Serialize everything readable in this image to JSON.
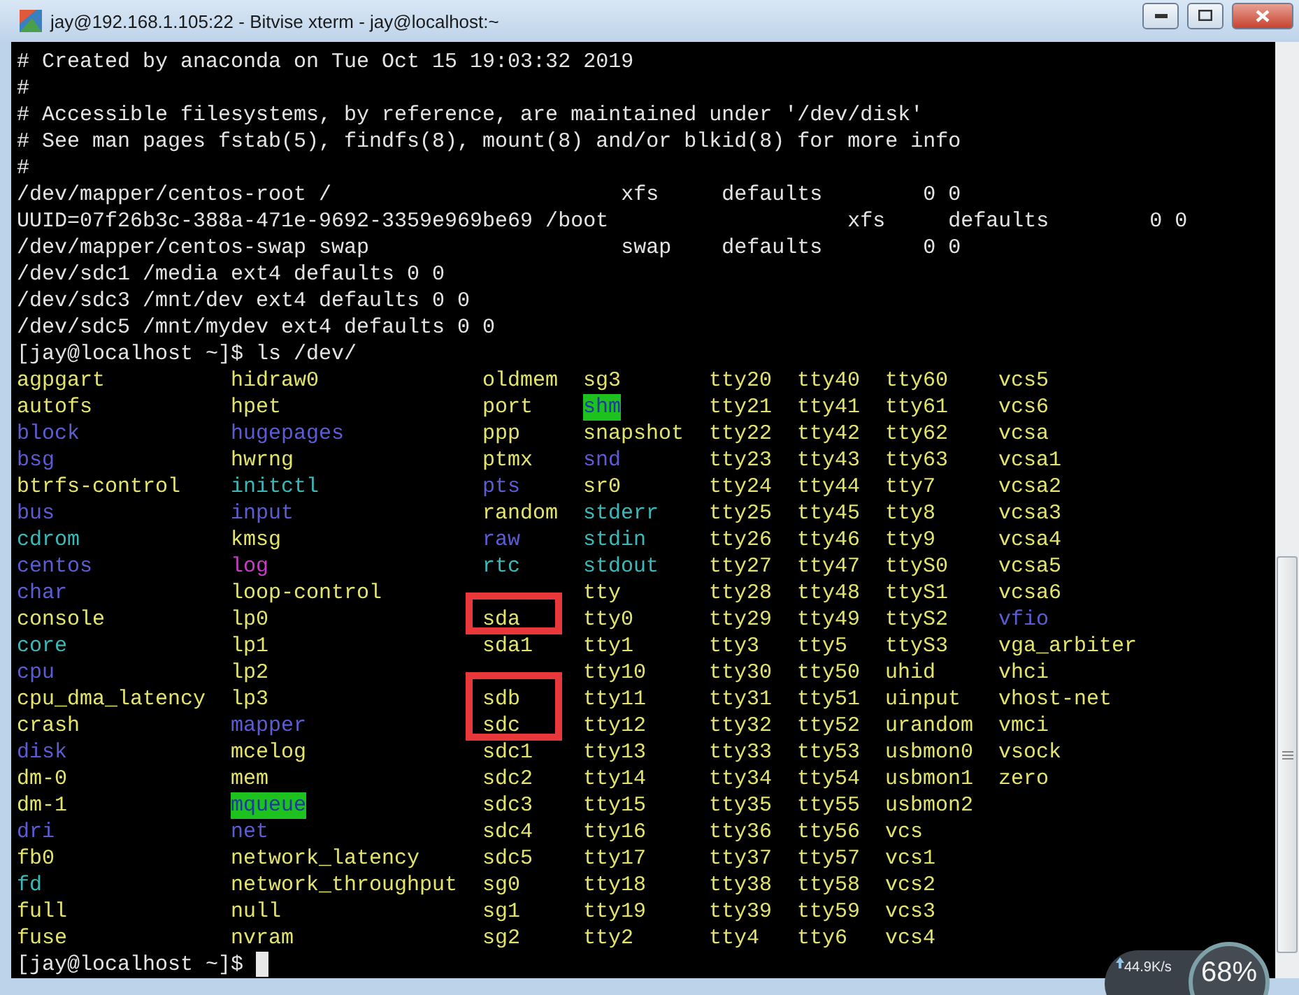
{
  "window": {
    "title": "jay@192.168.1.105:22 - Bitvise xterm - jay@localhost:~"
  },
  "terminal": {
    "lines": [
      "# Created by anaconda on Tue Oct 15 19:03:32 2019",
      "#",
      "# Accessible filesystems, by reference, are maintained under '/dev/disk'",
      "# See man pages fstab(5), findfs(8), mount(8) and/or blkid(8) for more info",
      "#",
      "/dev/mapper/centos-root /                       xfs     defaults        0 0",
      "UUID=07f26b3c-388a-471e-9692-3359e969be69 /boot                   xfs     defaults        0 0",
      "/dev/mapper/centos-swap swap                    swap    defaults        0 0",
      "/dev/sdc1 /media ext4 defaults 0 0",
      "/dev/sdc3 /mnt/dev ext4 defaults 0 0",
      "/dev/sdc5 /mnt/mydev ext4 defaults 0 0",
      "[jay@localhost ~]$ ls /dev/"
    ],
    "listing": {
      "columns": [
        {
          "entries": [
            {
              "name": "agpgart",
              "kind": "dev"
            },
            {
              "name": "autofs",
              "kind": "dev"
            },
            {
              "name": "block",
              "kind": "dir"
            },
            {
              "name": "bsg",
              "kind": "dir"
            },
            {
              "name": "btrfs-control",
              "kind": "dev"
            },
            {
              "name": "bus",
              "kind": "dir"
            },
            {
              "name": "cdrom",
              "kind": "link"
            },
            {
              "name": "centos",
              "kind": "dir"
            },
            {
              "name": "char",
              "kind": "dir"
            },
            {
              "name": "console",
              "kind": "dev"
            },
            {
              "name": "core",
              "kind": "link"
            },
            {
              "name": "cpu",
              "kind": "dir"
            },
            {
              "name": "cpu_dma_latency",
              "kind": "dev"
            },
            {
              "name": "crash",
              "kind": "dev"
            },
            {
              "name": "disk",
              "kind": "dir"
            },
            {
              "name": "dm-0",
              "kind": "dev"
            },
            {
              "name": "dm-1",
              "kind": "dev"
            },
            {
              "name": "dri",
              "kind": "dir"
            },
            {
              "name": "fb0",
              "kind": "dev"
            },
            {
              "name": "fd",
              "kind": "link"
            },
            {
              "name": "full",
              "kind": "dev"
            },
            {
              "name": "fuse",
              "kind": "dev"
            }
          ]
        },
        {
          "entries": [
            {
              "name": "hidraw0",
              "kind": "dev"
            },
            {
              "name": "hpet",
              "kind": "dev"
            },
            {
              "name": "hugepages",
              "kind": "dir"
            },
            {
              "name": "hwrng",
              "kind": "dev"
            },
            {
              "name": "initctl",
              "kind": "link"
            },
            {
              "name": "input",
              "kind": "dir"
            },
            {
              "name": "kmsg",
              "kind": "dev"
            },
            {
              "name": "log",
              "kind": "sock"
            },
            {
              "name": "loop-control",
              "kind": "dev"
            },
            {
              "name": "lp0",
              "kind": "dev"
            },
            {
              "name": "lp1",
              "kind": "dev"
            },
            {
              "name": "lp2",
              "kind": "dev"
            },
            {
              "name": "lp3",
              "kind": "dev"
            },
            {
              "name": "mapper",
              "kind": "dir"
            },
            {
              "name": "mcelog",
              "kind": "dev"
            },
            {
              "name": "mem",
              "kind": "dev"
            },
            {
              "name": "mqueue",
              "kind": "sticky"
            },
            {
              "name": "net",
              "kind": "dir"
            },
            {
              "name": "network_latency",
              "kind": "dev"
            },
            {
              "name": "network_throughput",
              "kind": "dev"
            },
            {
              "name": "null",
              "kind": "dev"
            },
            {
              "name": "nvram",
              "kind": "dev"
            }
          ]
        },
        {
          "entries": [
            {
              "name": "oldmem",
              "kind": "dev"
            },
            {
              "name": "port",
              "kind": "dev"
            },
            {
              "name": "ppp",
              "kind": "dev"
            },
            {
              "name": "ptmx",
              "kind": "dev"
            },
            {
              "name": "pts",
              "kind": "dir"
            },
            {
              "name": "random",
              "kind": "dev"
            },
            {
              "name": "raw",
              "kind": "dir"
            },
            {
              "name": "rtc",
              "kind": "link"
            },
            {
              "kind": "covered"
            },
            {
              "name": "sda",
              "kind": "dev",
              "marked": true
            },
            {
              "name": "sda1",
              "kind": "dev"
            },
            {
              "kind": "covered"
            },
            {
              "name": "sdb",
              "kind": "dev",
              "marked": true
            },
            {
              "name": "sdc",
              "kind": "dev",
              "marked": true
            },
            {
              "name": "sdc1",
              "kind": "dev"
            },
            {
              "name": "sdc2",
              "kind": "dev"
            },
            {
              "name": "sdc3",
              "kind": "dev"
            },
            {
              "name": "sdc4",
              "kind": "dev"
            },
            {
              "name": "sdc5",
              "kind": "dev"
            },
            {
              "name": "sg0",
              "kind": "dev"
            },
            {
              "name": "sg1",
              "kind": "dev"
            },
            {
              "name": "sg2",
              "kind": "dev"
            }
          ]
        },
        {
          "entries": [
            {
              "name": "sg3",
              "kind": "dev"
            },
            {
              "name": "shm",
              "kind": "sticky"
            },
            {
              "name": "snapshot",
              "kind": "dev"
            },
            {
              "name": "snd",
              "kind": "dir"
            },
            {
              "name": "sr0",
              "kind": "dev"
            },
            {
              "name": "stderr",
              "kind": "link"
            },
            {
              "name": "stdin",
              "kind": "link"
            },
            {
              "name": "stdout",
              "kind": "link"
            },
            {
              "name": "tty",
              "kind": "dev"
            },
            {
              "name": "tty0",
              "kind": "dev"
            },
            {
              "name": "tty1",
              "kind": "dev"
            },
            {
              "name": "tty10",
              "kind": "dev"
            },
            {
              "name": "tty11",
              "kind": "dev"
            },
            {
              "name": "tty12",
              "kind": "dev"
            },
            {
              "name": "tty13",
              "kind": "dev"
            },
            {
              "name": "tty14",
              "kind": "dev"
            },
            {
              "name": "tty15",
              "kind": "dev"
            },
            {
              "name": "tty16",
              "kind": "dev"
            },
            {
              "name": "tty17",
              "kind": "dev"
            },
            {
              "name": "tty18",
              "kind": "dev"
            },
            {
              "name": "tty19",
              "kind": "dev"
            },
            {
              "name": "tty2",
              "kind": "dev"
            }
          ]
        },
        {
          "entries": [
            {
              "name": "tty20",
              "kind": "dev"
            },
            {
              "name": "tty21",
              "kind": "dev"
            },
            {
              "name": "tty22",
              "kind": "dev"
            },
            {
              "name": "tty23",
              "kind": "dev"
            },
            {
              "name": "tty24",
              "kind": "dev"
            },
            {
              "name": "tty25",
              "kind": "dev"
            },
            {
              "name": "tty26",
              "kind": "dev"
            },
            {
              "name": "tty27",
              "kind": "dev"
            },
            {
              "name": "tty28",
              "kind": "dev"
            },
            {
              "name": "tty29",
              "kind": "dev"
            },
            {
              "name": "tty3",
              "kind": "dev"
            },
            {
              "name": "tty30",
              "kind": "dev"
            },
            {
              "name": "tty31",
              "kind": "dev"
            },
            {
              "name": "tty32",
              "kind": "dev"
            },
            {
              "name": "tty33",
              "kind": "dev"
            },
            {
              "name": "tty34",
              "kind": "dev"
            },
            {
              "name": "tty35",
              "kind": "dev"
            },
            {
              "name": "tty36",
              "kind": "dev"
            },
            {
              "name": "tty37",
              "kind": "dev"
            },
            {
              "name": "tty38",
              "kind": "dev"
            },
            {
              "name": "tty39",
              "kind": "dev"
            },
            {
              "name": "tty4",
              "kind": "dev"
            }
          ]
        },
        {
          "entries": [
            {
              "name": "tty40",
              "kind": "dev"
            },
            {
              "name": "tty41",
              "kind": "dev"
            },
            {
              "name": "tty42",
              "kind": "dev"
            },
            {
              "name": "tty43",
              "kind": "dev"
            },
            {
              "name": "tty44",
              "kind": "dev"
            },
            {
              "name": "tty45",
              "kind": "dev"
            },
            {
              "name": "tty46",
              "kind": "dev"
            },
            {
              "name": "tty47",
              "kind": "dev"
            },
            {
              "name": "tty48",
              "kind": "dev"
            },
            {
              "name": "tty49",
              "kind": "dev"
            },
            {
              "name": "tty5",
              "kind": "dev"
            },
            {
              "name": "tty50",
              "kind": "dev"
            },
            {
              "name": "tty51",
              "kind": "dev"
            },
            {
              "name": "tty52",
              "kind": "dev"
            },
            {
              "name": "tty53",
              "kind": "dev"
            },
            {
              "name": "tty54",
              "kind": "dev"
            },
            {
              "name": "tty55",
              "kind": "dev"
            },
            {
              "name": "tty56",
              "kind": "dev"
            },
            {
              "name": "tty57",
              "kind": "dev"
            },
            {
              "name": "tty58",
              "kind": "dev"
            },
            {
              "name": "tty59",
              "kind": "dev"
            },
            {
              "name": "tty6",
              "kind": "dev"
            }
          ]
        },
        {
          "entries": [
            {
              "name": "tty60",
              "kind": "dev"
            },
            {
              "name": "tty61",
              "kind": "dev"
            },
            {
              "name": "tty62",
              "kind": "dev"
            },
            {
              "name": "tty63",
              "kind": "dev"
            },
            {
              "name": "tty7",
              "kind": "dev"
            },
            {
              "name": "tty8",
              "kind": "dev"
            },
            {
              "name": "tty9",
              "kind": "dev"
            },
            {
              "name": "ttyS0",
              "kind": "dev"
            },
            {
              "name": "ttyS1",
              "kind": "dev"
            },
            {
              "name": "ttyS2",
              "kind": "dev"
            },
            {
              "name": "ttyS3",
              "kind": "dev"
            },
            {
              "name": "uhid",
              "kind": "dev"
            },
            {
              "name": "uinput",
              "kind": "dev"
            },
            {
              "name": "urandom",
              "kind": "dev"
            },
            {
              "name": "usbmon0",
              "kind": "dev"
            },
            {
              "name": "usbmon1",
              "kind": "dev"
            },
            {
              "name": "usbmon2",
              "kind": "dev"
            },
            {
              "name": "vcs",
              "kind": "dev"
            },
            {
              "name": "vcs1",
              "kind": "dev"
            },
            {
              "name": "vcs2",
              "kind": "dev"
            },
            {
              "name": "vcs3",
              "kind": "dev"
            },
            {
              "name": "vcs4",
              "kind": "dev"
            }
          ]
        },
        {
          "entries": [
            {
              "name": "vcs5",
              "kind": "dev"
            },
            {
              "name": "vcs6",
              "kind": "dev"
            },
            {
              "name": "vcsa",
              "kind": "dev"
            },
            {
              "name": "vcsa1",
              "kind": "dev"
            },
            {
              "name": "vcsa2",
              "kind": "dev"
            },
            {
              "name": "vcsa3",
              "kind": "dev"
            },
            {
              "name": "vcsa4",
              "kind": "dev"
            },
            {
              "name": "vcsa5",
              "kind": "dev"
            },
            {
              "name": "vcsa6",
              "kind": "dev"
            },
            {
              "name": "vfio",
              "kind": "dir"
            },
            {
              "name": "vga_arbiter",
              "kind": "dev"
            },
            {
              "name": "vhci",
              "kind": "dev"
            },
            {
              "name": "vhost-net",
              "kind": "dev"
            },
            {
              "name": "vmci",
              "kind": "dev"
            },
            {
              "name": "vsock",
              "kind": "dev"
            },
            {
              "name": "zero",
              "kind": "dev"
            }
          ]
        }
      ]
    },
    "prompt": "[jay@localhost ~]$"
  },
  "speed_widget": {
    "upload": "44.9K/s",
    "load": "68%"
  }
}
